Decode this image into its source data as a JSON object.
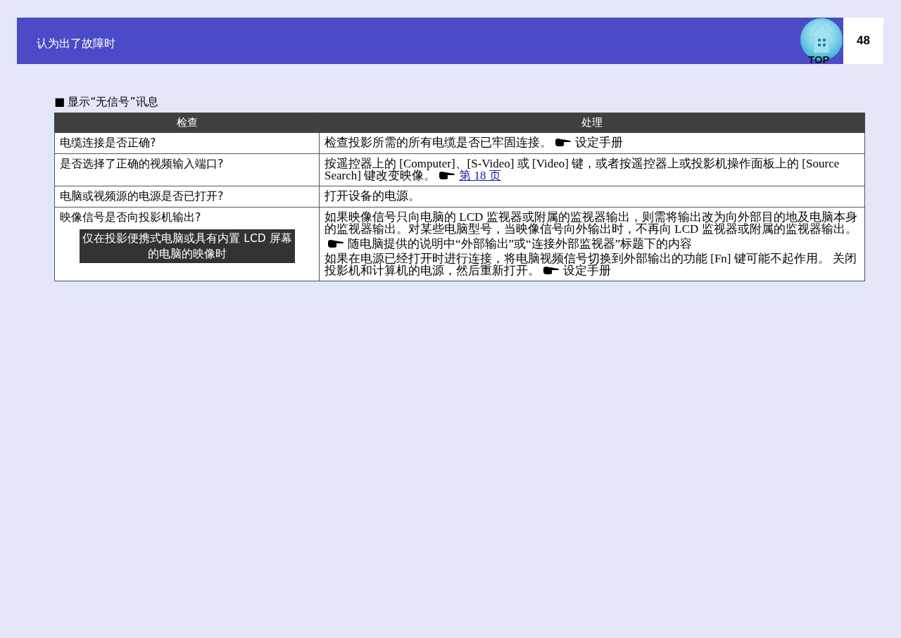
{
  "header": {
    "title": "认为出了故障时",
    "top_button": "TOP",
    "page_number": "48"
  },
  "section": {
    "marker": "■",
    "title": "显示“无信号”讯息"
  },
  "table": {
    "columns": [
      "检查",
      "处理"
    ],
    "rows": [
      {
        "check": "电缆连接是否正确?",
        "note": null,
        "paragraphs": [
          [
            {
              "kind": "text",
              "text": "检查投影所需的所有电缆是否已牢固连接。"
            },
            {
              "kind": "pointer"
            },
            {
              "kind": "text",
              "text": "设定手册"
            }
          ]
        ]
      },
      {
        "check": "是否选择了正确的视频输入端口?",
        "note": null,
        "paragraphs": [
          [
            {
              "kind": "text",
              "text": "按遥控器上的 [Computer]、[S-Video] 或 [Video] 键，或者按遥控器上或投影机操作面板上的 [Source Search] 键改变映像。"
            },
            {
              "kind": "pointer"
            },
            {
              "kind": "link",
              "text": "第 18 页"
            }
          ]
        ]
      },
      {
        "check": "电脑或视频源的电源是否已打开?",
        "note": null,
        "paragraphs": [
          [
            {
              "kind": "text",
              "text": "打开设备的电源。"
            }
          ]
        ]
      },
      {
        "check": "映像信号是否向投影机输出?",
        "note": "仅在投影便携式电脑或具有内置 LCD 屏幕的电脑的映像时",
        "paragraphs": [
          [
            {
              "kind": "text",
              "text": "如果映像信号只向电脑的 LCD 监视器或附属的监视器输出，则需将输出改为向外部目的地及电脑本身的监视器输出。对某些电脑型号，当映像信号向外输出时，不再向 LCD 监视器或附属的监视器输出。"
            }
          ],
          [
            {
              "kind": "pointer"
            },
            {
              "kind": "text",
              "text": "随电脑提供的说明中“外部输出”或“连接外部监视器”标题下的内容"
            }
          ],
          [
            {
              "kind": "text",
              "text": "如果在电源已经打开时进行连接，将电脑视频信号切换到外部输出的功能 [Fn] 键可能不起作用。 关闭投影机和计算机的电源，然后重新打开。"
            },
            {
              "kind": "pointer"
            },
            {
              "kind": "text",
              "text": "设定手册"
            }
          ]
        ]
      }
    ]
  }
}
